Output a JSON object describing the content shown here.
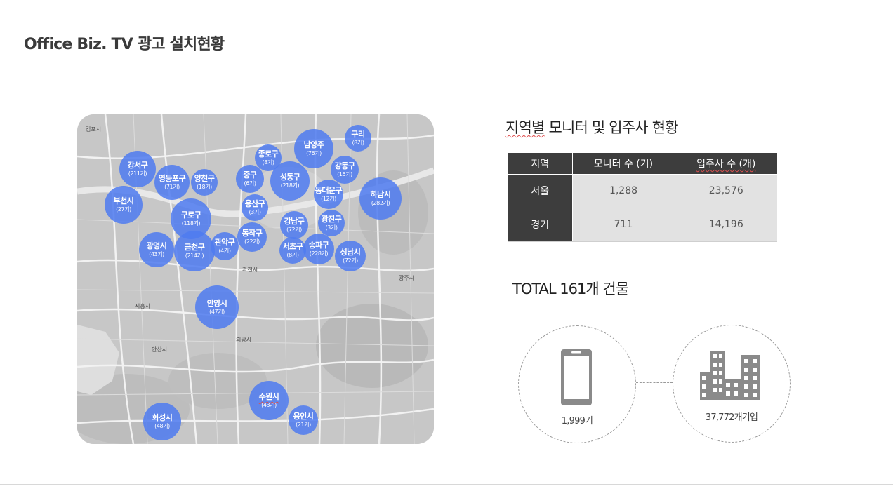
{
  "slide": {
    "title": "Office Biz. TV 광고 설치현황"
  },
  "map": {
    "labels": {
      "gimpo": "김포시",
      "siheung": "시흥시",
      "gwacheon": "과천시",
      "ansan": "안산시",
      "gwangju": "광주시",
      "uiwang": "의왕시"
    },
    "bubbles": [
      {
        "name": "강서구",
        "count": "(211기)"
      },
      {
        "name": "영등포구",
        "count": "(71기)"
      },
      {
        "name": "양천구",
        "count": "(18기)"
      },
      {
        "name": "부천시",
        "count": "(27기)"
      },
      {
        "name": "구로구",
        "count": "(118기)"
      },
      {
        "name": "광명시",
        "count": "(43기)"
      },
      {
        "name": "금천구",
        "count": "(214기)"
      },
      {
        "name": "관악구",
        "count": "(4기)"
      },
      {
        "name": "동작구",
        "count": "(22기)"
      },
      {
        "name": "종로구",
        "count": "(8기)"
      },
      {
        "name": "중구",
        "count": "(6기)"
      },
      {
        "name": "용산구",
        "count": "(3기)"
      },
      {
        "name": "성동구",
        "count": "(218기)"
      },
      {
        "name": "남양주",
        "count": "(76기)"
      },
      {
        "name": "구리",
        "count": "(8기)"
      },
      {
        "name": "강동구",
        "count": "(15기)"
      },
      {
        "name": "동대문구",
        "count": "(12기)"
      },
      {
        "name": "하남시",
        "count": "(282기)"
      },
      {
        "name": "강남구",
        "count": "(72기)"
      },
      {
        "name": "광진구",
        "count": "(3기)"
      },
      {
        "name": "서초구",
        "count": "(8기)"
      },
      {
        "name": "송파구",
        "count": "(228기)"
      },
      {
        "name": "성남시",
        "count": "(72기)"
      },
      {
        "name": "안양시",
        "count": "(47기)"
      },
      {
        "name": "수원시",
        "count": "(43기)"
      },
      {
        "name": "용인시",
        "count": "(21기)"
      },
      {
        "name": "화성시",
        "count": "(48기)"
      }
    ]
  },
  "regional": {
    "title_prefix": "지역별",
    "title_rest": " 모니터 및 입주사 현황",
    "table": {
      "headers": [
        "지역",
        "모니터 수 (기)",
        "입주사 수 (개)"
      ],
      "rows": [
        {
          "region": "서울",
          "monitors": "1,288",
          "tenants": "23,576"
        },
        {
          "region": "경기",
          "monitors": "711",
          "tenants": "14,196"
        }
      ]
    }
  },
  "total": {
    "title": "TOTAL 161개 건물",
    "monitors_value": "1,999기",
    "companies_value": "37,772개기업"
  },
  "icons": {
    "phone": "smartphone-icon",
    "buildings": "buildings-icon"
  },
  "colors": {
    "bubble": "#4f7bf0",
    "table_header": "#3d3d3d",
    "table_cell": "#e2e2e2"
  }
}
